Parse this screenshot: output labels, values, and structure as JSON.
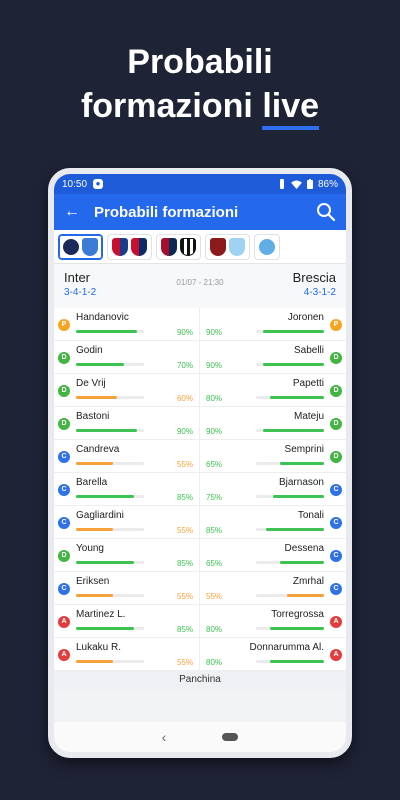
{
  "promo": {
    "line1": "Probabili",
    "line2a": "formazioni",
    "line2b": "live"
  },
  "status": {
    "time": "10:50",
    "battery": "86%"
  },
  "appbar": {
    "title": "Probabili formazioni"
  },
  "match": {
    "home": "Inter",
    "home_form": "3-4-1-2",
    "away": "Brescia",
    "away_form": "4-3-1-2",
    "datetime": "01/07 - 21:30"
  },
  "colors": {
    "green": "#3cc351",
    "orange": "#f5a23a",
    "blue": "#2468ec",
    "P": "#f4a623",
    "D": "#43b543",
    "C": "#2f72e8",
    "A": "#e23d3d"
  },
  "rows": [
    {
      "home": {
        "name": "Handanovic",
        "role": "P",
        "pct": "90%",
        "value": 0.9,
        "color": "green"
      },
      "away": {
        "name": "Joronen",
        "role": "P",
        "pct": "90%",
        "value": 0.9,
        "color": "green"
      }
    },
    {
      "home": {
        "name": "Godin",
        "role": "D",
        "pct": "70%",
        "value": 0.7,
        "color": "green"
      },
      "away": {
        "name": "Sabelli",
        "role": "D",
        "pct": "90%",
        "value": 0.9,
        "color": "green"
      }
    },
    {
      "home": {
        "name": "De Vrij",
        "role": "D",
        "pct": "60%",
        "value": 0.6,
        "color": "orange"
      },
      "away": {
        "name": "Papetti",
        "role": "D",
        "pct": "80%",
        "value": 0.8,
        "color": "green"
      }
    },
    {
      "home": {
        "name": "Bastoni",
        "role": "D",
        "pct": "90%",
        "value": 0.9,
        "color": "green"
      },
      "away": {
        "name": "Mateju",
        "role": "D",
        "pct": "90%",
        "value": 0.9,
        "color": "green"
      }
    },
    {
      "home": {
        "name": "Candreva",
        "role": "C",
        "pct": "55%",
        "value": 0.55,
        "color": "orange"
      },
      "away": {
        "name": "Semprini",
        "role": "D",
        "pct": "65%",
        "value": 0.65,
        "color": "green"
      }
    },
    {
      "home": {
        "name": "Barella",
        "role": "C",
        "pct": "85%",
        "value": 0.85,
        "color": "green"
      },
      "away": {
        "name": "Bjarnason",
        "role": "C",
        "pct": "75%",
        "value": 0.75,
        "color": "green"
      }
    },
    {
      "home": {
        "name": "Gagliardini",
        "role": "C",
        "pct": "55%",
        "value": 0.55,
        "color": "orange"
      },
      "away": {
        "name": "Tonali",
        "role": "C",
        "pct": "85%",
        "value": 0.85,
        "color": "green"
      }
    },
    {
      "home": {
        "name": "Young",
        "role": "D",
        "pct": "85%",
        "value": 0.85,
        "color": "green"
      },
      "away": {
        "name": "Dessena",
        "role": "C",
        "pct": "65%",
        "value": 0.65,
        "color": "green"
      }
    },
    {
      "home": {
        "name": "Eriksen",
        "role": "C",
        "pct": "55%",
        "value": 0.55,
        "color": "orange"
      },
      "away": {
        "name": "Zmrhal",
        "role": "C",
        "pct": "55%",
        "value": 0.55,
        "color": "orange"
      }
    },
    {
      "home": {
        "name": "Martinez L.",
        "role": "A",
        "pct": "85%",
        "value": 0.85,
        "color": "green"
      },
      "away": {
        "name": "Torregrossa",
        "role": "A",
        "pct": "80%",
        "value": 0.8,
        "color": "green"
      }
    },
    {
      "home": {
        "name": "Lukaku R.",
        "role": "A",
        "pct": "55%",
        "value": 0.55,
        "color": "orange"
      },
      "away": {
        "name": "Donnarumma Al.",
        "role": "A",
        "pct": "80%",
        "value": 0.8,
        "color": "green"
      }
    }
  ],
  "bench_label": "Panchina"
}
